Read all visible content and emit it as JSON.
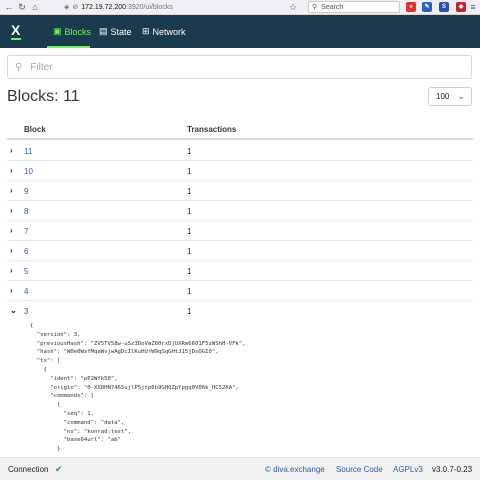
{
  "browser": {
    "url_host": "172.19.72.200",
    "url_path": ":3920/ui/blocks",
    "search_placeholder": "Search",
    "back_icon": "back-arrow-icon",
    "reload_icon": "reload-icon"
  },
  "navbar": {
    "logo": "X",
    "items": [
      {
        "label": "Blocks",
        "icon": "cube-icon"
      },
      {
        "label": "State",
        "icon": "book-icon"
      },
      {
        "label": "Network",
        "icon": "sitemap-icon"
      }
    ],
    "accent_color": "#6ff35a",
    "background": "#193b4d"
  },
  "filter": {
    "placeholder": "Filter"
  },
  "title": "Blocks: 11",
  "page_size": {
    "selected": "100"
  },
  "table": {
    "headers": {
      "block": "Block",
      "transactions": "Transactions"
    },
    "rows": [
      {
        "block": "11",
        "tx": "1"
      },
      {
        "block": "10",
        "tx": "1"
      },
      {
        "block": "9",
        "tx": "1"
      },
      {
        "block": "8",
        "tx": "1"
      },
      {
        "block": "7",
        "tx": "1"
      },
      {
        "block": "6",
        "tx": "1"
      },
      {
        "block": "5",
        "tx": "1"
      },
      {
        "block": "4",
        "tx": "1"
      },
      {
        "block": "3",
        "tx": "1"
      }
    ],
    "expanded_row": "3"
  },
  "block_json": "{\n  \"version\": 3,\n  \"previousHash\": \"ZV5TV58w-uSz3DoVmZ60rxDjUXRm6601F5zWShH-VFk\",\n  \"hash\": \"W0e0WzfMqaWvjwAgDcIlKuHUrW9qSqGHtJ15jDsOGI0\",\n  \"tx\": [\n    {\n      \"ident\": \"pP2Wfk50\",\n      \"origin\": \"0-XX8HN746SujlP5jtp6b9GHQZpfpgq0V06k_HC52KA\",\n      \"commands\": [\n        {\n          \"seq\": 1,\n          \"command\": \"data\",\n          \"ns\": \"konrad:test\",\n          \"base64url\": \"ab\"\n        }",
  "footer": {
    "connection": "Connection",
    "links": [
      "© diva.exchange",
      "Source Code",
      "AGPLv3"
    ],
    "version": "v3.0.7-0.23",
    "status_color": "#2e9b4c"
  }
}
